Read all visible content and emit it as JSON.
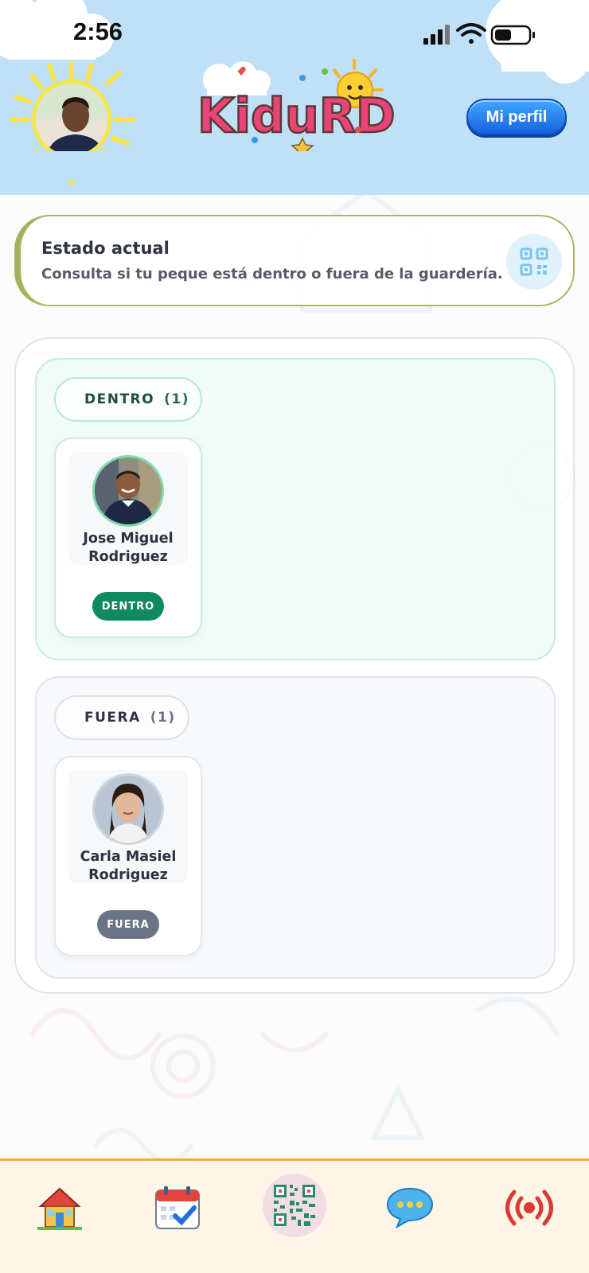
{
  "status_bar": {
    "time": "2:56"
  },
  "header": {
    "logo_text": "KiduRD",
    "profile_button": "Mi perfil"
  },
  "estado_card": {
    "title": "Estado actual",
    "description": "Consulta si tu peque está dentro o fuera de la guardería.",
    "icon": "qr-code-icon"
  },
  "sections": {
    "inside": {
      "label": "DENTRO",
      "count": "(1)",
      "children": [
        {
          "name_line1": "Jose Miguel",
          "name_line2": "Rodriguez",
          "badge": "DENTRO"
        }
      ]
    },
    "outside": {
      "label": "FUERA",
      "count": "(1)",
      "children": [
        {
          "name_line1": "Carla Masiel",
          "name_line2": "Rodriguez",
          "badge": "FUERA"
        }
      ]
    }
  },
  "bottom_nav": {
    "items": [
      "home-icon",
      "calendar-icon",
      "qr-code-icon",
      "chat-icon",
      "live-broadcast-icon"
    ]
  },
  "colors": {
    "header_bg": "#bfe0f6",
    "inside_accent": "#0f8a5e",
    "outside_accent": "#6b7386",
    "profile_button": "#1f7ef0",
    "nav_border": "#f4ab38"
  }
}
